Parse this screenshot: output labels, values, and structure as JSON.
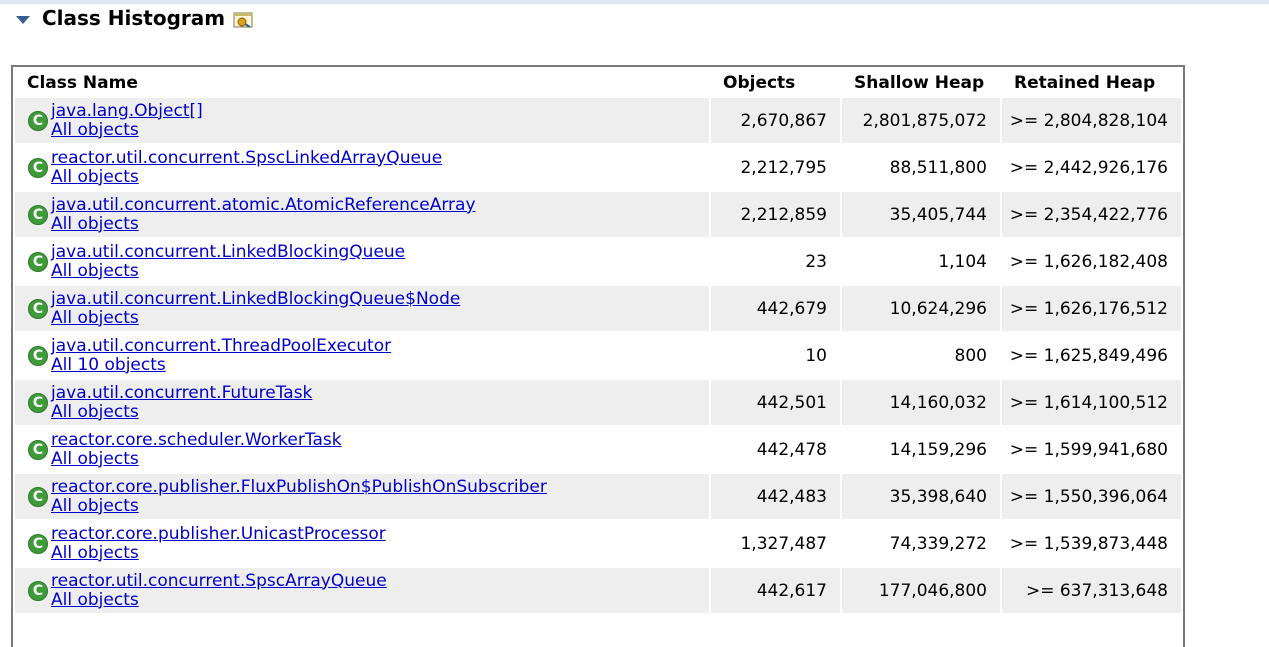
{
  "section": {
    "title": "Class Histogram"
  },
  "columns": {
    "class_name": "Class Name",
    "objects": "Objects",
    "shallow_heap": "Shallow Heap",
    "retained_heap": "Retained Heap"
  },
  "rows": [
    {
      "class": "java.lang.Object[]",
      "link": "All objects",
      "objects": "2,670,867",
      "shallow": "2,801,875,072",
      "retained": ">= 2,804,828,104"
    },
    {
      "class": "reactor.util.concurrent.SpscLinkedArrayQueue",
      "link": "All objects",
      "objects": "2,212,795",
      "shallow": "88,511,800",
      "retained": ">= 2,442,926,176"
    },
    {
      "class": "java.util.concurrent.atomic.AtomicReferenceArray",
      "link": "All objects",
      "objects": "2,212,859",
      "shallow": "35,405,744",
      "retained": ">= 2,354,422,776"
    },
    {
      "class": "java.util.concurrent.LinkedBlockingQueue",
      "link": "All objects",
      "objects": "23",
      "shallow": "1,104",
      "retained": ">= 1,626,182,408"
    },
    {
      "class": "java.util.concurrent.LinkedBlockingQueue$Node",
      "link": "All objects",
      "objects": "442,679",
      "shallow": "10,624,296",
      "retained": ">= 1,626,176,512"
    },
    {
      "class": "java.util.concurrent.ThreadPoolExecutor",
      "link": "All 10 objects",
      "objects": "10",
      "shallow": "800",
      "retained": ">= 1,625,849,496"
    },
    {
      "class": "java.util.concurrent.FutureTask",
      "link": "All objects",
      "objects": "442,501",
      "shallow": "14,160,032",
      "retained": ">= 1,614,100,512"
    },
    {
      "class": "reactor.core.scheduler.WorkerTask",
      "link": "All objects",
      "objects": "442,478",
      "shallow": "14,159,296",
      "retained": ">= 1,599,941,680"
    },
    {
      "class": "reactor.core.publisher.FluxPublishOn$PublishOnSubscriber",
      "link": "All objects",
      "objects": "442,483",
      "shallow": "35,398,640",
      "retained": ">= 1,550,396,064"
    },
    {
      "class": "reactor.core.publisher.UnicastProcessor",
      "link": "All objects",
      "objects": "1,327,487",
      "shallow": "74,339,272",
      "retained": ">= 1,539,873,448"
    },
    {
      "class": "reactor.util.concurrent.SpscArrayQueue",
      "link": "All objects",
      "objects": "442,617",
      "shallow": "177,046,800",
      "retained": ">= 637,313,648"
    }
  ],
  "icons": {
    "class_icon": "class-c-icon",
    "class_icon_letter": "C",
    "class_icon_color": "#3f9a3a",
    "link_color": "#0000cc"
  }
}
